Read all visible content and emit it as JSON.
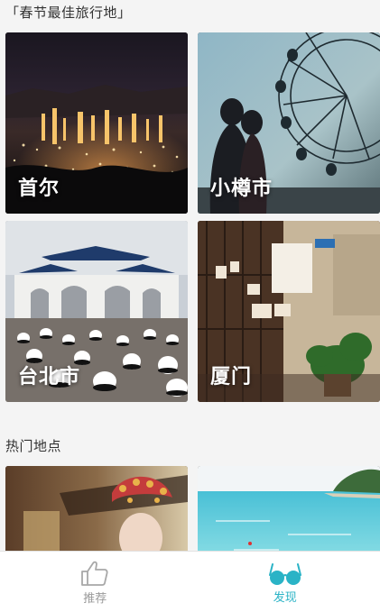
{
  "sections": {
    "featured_title": "「春节最佳旅行地」",
    "popular_title": "热门地点"
  },
  "destinations": [
    {
      "name": "首尔"
    },
    {
      "name": "小樽市"
    },
    {
      "name": "台北市"
    },
    {
      "name": "厦门"
    }
  ],
  "tabbar": {
    "items": [
      {
        "label": "推荐",
        "icon": "thumbs-up-icon",
        "active": false
      },
      {
        "label": "发现",
        "icon": "glasses-icon",
        "active": true
      }
    ]
  },
  "colors": {
    "accent": "#2ab3c6",
    "inactive": "#9a9a9a",
    "background": "#f4f4f4"
  }
}
